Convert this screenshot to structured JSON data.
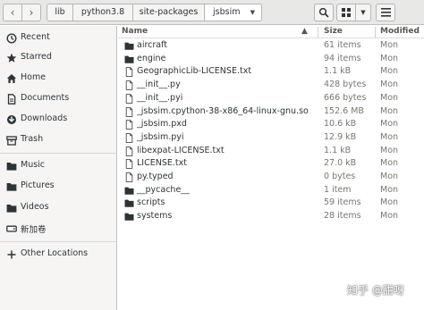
{
  "toolbar": {
    "back_glyph": "‹",
    "forward_glyph": "›",
    "search_icon": "search-icon",
    "view_icon": "grid-view-icon",
    "menu_icon": "hamburger-menu-icon"
  },
  "breadcrumb": [
    "lib",
    "python3.8",
    "site-packages",
    "jsbsim"
  ],
  "sidebar": {
    "items": [
      {
        "label": "Recent",
        "icon": "clock-icon"
      },
      {
        "label": "Starred",
        "icon": "star-icon"
      },
      {
        "label": "Home",
        "icon": "home-icon"
      },
      {
        "label": "Documents",
        "icon": "document-icon"
      },
      {
        "label": "Downloads",
        "icon": "download-icon"
      },
      {
        "label": "Trash",
        "icon": "trash-icon"
      },
      {
        "label": "Music",
        "icon": "folder-icon"
      },
      {
        "label": "Pictures",
        "icon": "folder-icon"
      },
      {
        "label": "Videos",
        "icon": "folder-icon"
      },
      {
        "label": "新加卷",
        "icon": "drive-icon"
      },
      {
        "label": "Other Locations",
        "icon": "plus-icon"
      }
    ]
  },
  "columns": {
    "name": "Name",
    "size": "Size",
    "modified": "Modified"
  },
  "files": [
    {
      "name": "aircraft",
      "size": "61 items",
      "modified": "Mon",
      "type": "folder"
    },
    {
      "name": "engine",
      "size": "94 items",
      "modified": "Mon",
      "type": "folder"
    },
    {
      "name": "GeographicLib-LICENSE.txt",
      "size": "1.1 kB",
      "modified": "Mon",
      "type": "file"
    },
    {
      "name": "__init__.py",
      "size": "428 bytes",
      "modified": "Mon",
      "type": "file"
    },
    {
      "name": "__init__.pyi",
      "size": "666 bytes",
      "modified": "Mon",
      "type": "file"
    },
    {
      "name": "_jsbsim.cpython-38-x86_64-linux-gnu.so",
      "size": "152.6 MB",
      "modified": "Mon",
      "type": "file"
    },
    {
      "name": "_jsbsim.pxd",
      "size": "10.6 kB",
      "modified": "Mon",
      "type": "file"
    },
    {
      "name": "_jsbsim.pyi",
      "size": "12.9 kB",
      "modified": "Mon",
      "type": "file"
    },
    {
      "name": "libexpat-LICENSE.txt",
      "size": "1.1 kB",
      "modified": "Mon",
      "type": "file"
    },
    {
      "name": "LICENSE.txt",
      "size": "27.0 kB",
      "modified": "Mon",
      "type": "file"
    },
    {
      "name": "py.typed",
      "size": "0 bytes",
      "modified": "Mon",
      "type": "file"
    },
    {
      "name": "__pycache__",
      "size": "1 item",
      "modified": "Mon",
      "type": "folder"
    },
    {
      "name": "scripts",
      "size": "59 items",
      "modified": "Mon",
      "type": "folder"
    },
    {
      "name": "systems",
      "size": "28 items",
      "modified": "Mon",
      "type": "folder"
    }
  ],
  "watermark": "知乎 @甜呀"
}
